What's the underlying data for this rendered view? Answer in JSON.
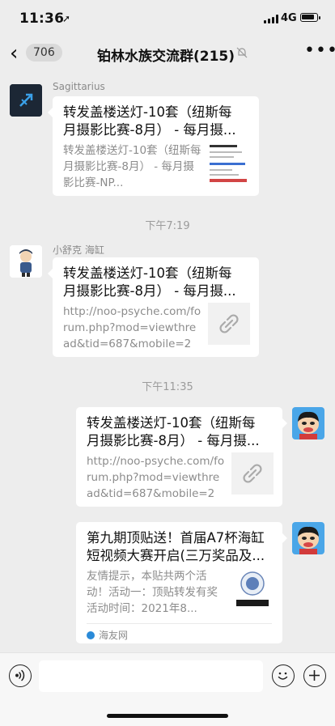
{
  "status": {
    "time": "11:36",
    "network": "4G"
  },
  "nav": {
    "back_count": "706",
    "title": "铂林水族交流群(215)"
  },
  "messages": [
    {
      "sender": "Sagittarius",
      "title": "转发盖楼送灯-10套（纽斯每月摄影比赛-8月） - 每月摄...",
      "desc": "转发盖楼送灯-10套（纽斯每月摄影比赛-8月） - 每月摄影比赛-NP..."
    },
    {
      "sender": "小舒克 海缸",
      "title": "转发盖楼送灯-10套（纽斯每月摄影比赛-8月） - 每月摄...",
      "desc": "http://noo-psyche.com/forum.php?mod=viewthread&tid=687&mobile=2"
    },
    {
      "title": "转发盖楼送灯-10套（纽斯每月摄影比赛-8月） - 每月摄...",
      "desc": "http://noo-psyche.com/forum.php?mod=viewthread&tid=687&mobile=2"
    },
    {
      "title": "第九期顶贴送！首届A7杯海缸短视频大赛开启(三万奖品及...",
      "desc": "友情提示，本贴共两个活动！活动一：顶贴转发有奖活动时间：2021年8...",
      "source": "海友网"
    }
  ],
  "timestamps": [
    "下午7:19",
    "下午11:35"
  ]
}
